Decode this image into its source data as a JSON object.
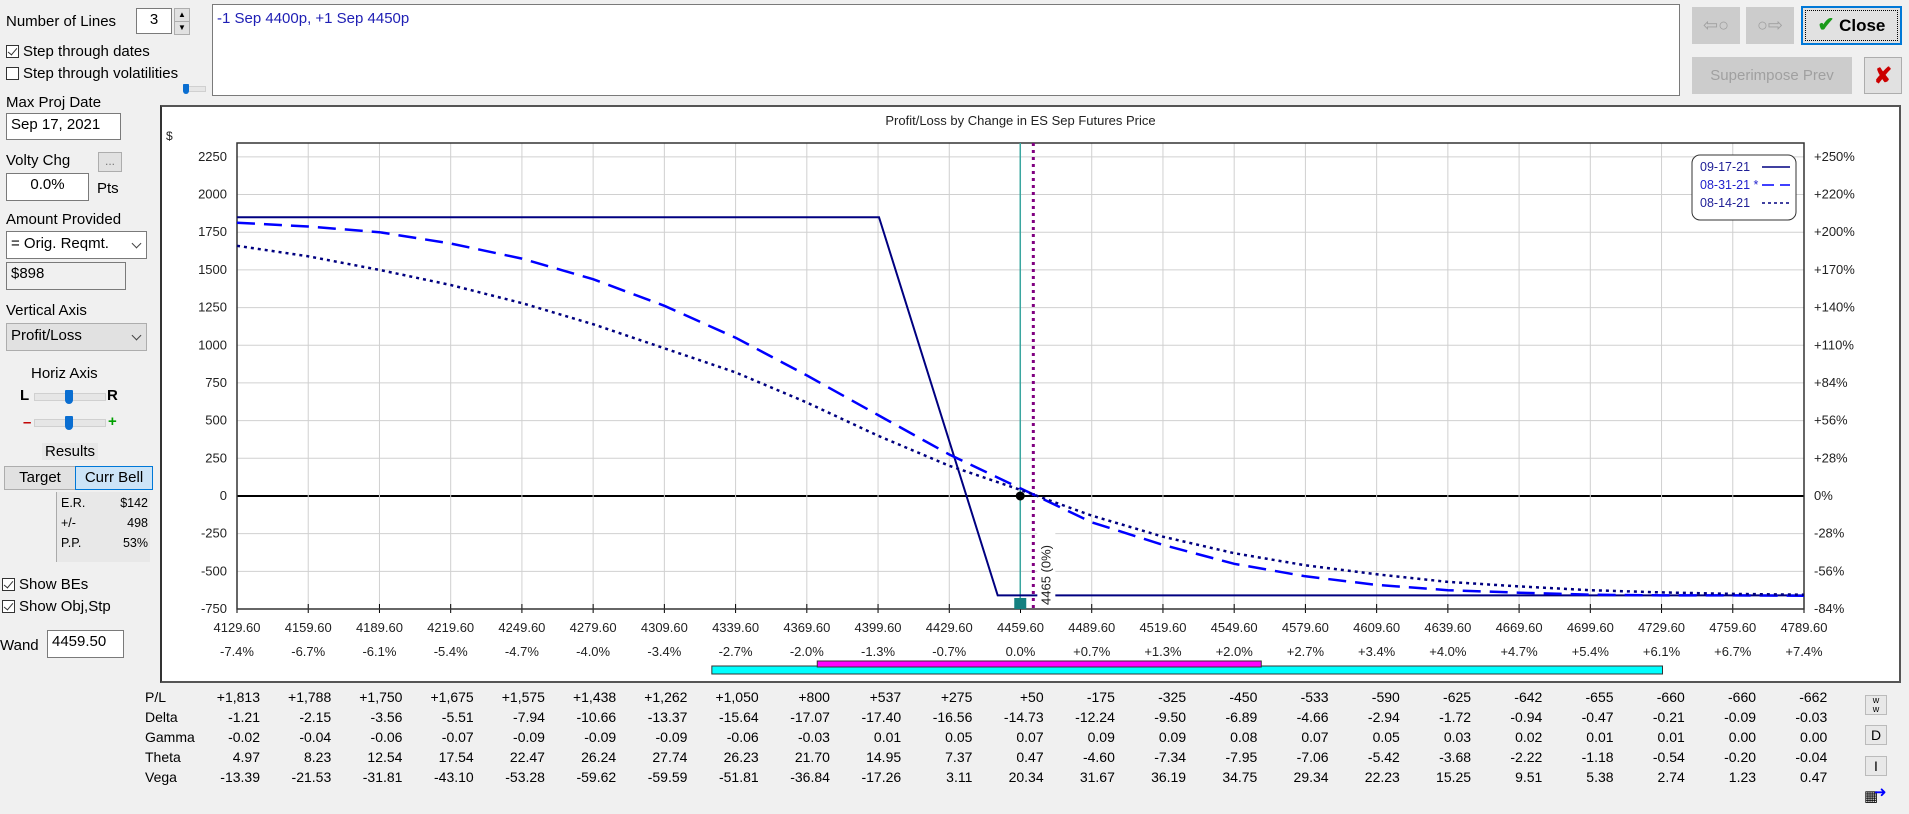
{
  "controls": {
    "num_lines_label": "Number of Lines",
    "num_lines_value": "3",
    "step_dates_label": "Step through dates",
    "step_dates_checked": true,
    "step_vols_label": "Step through volatilities",
    "step_vols_checked": false,
    "max_proj_date_label": "Max Proj Date",
    "max_proj_date_value": "Sep 17, 2021",
    "volty_chg_label": "Volty Chg",
    "volty_btn_label": "...",
    "volty_value": "0.0%",
    "volty_units": "Pts",
    "amount_label": "Amount Provided",
    "amount_select": "= Orig. Reqmt.",
    "amount_value": "$898",
    "vertical_axis_label": "Vertical Axis",
    "vertical_axis_select": "Profit/Loss",
    "horiz_axis_label": "Horiz Axis",
    "horiz_l": "L",
    "horiz_r": "R",
    "zoom_minus": "–",
    "zoom_plus": "+",
    "results_label": "Results",
    "target_btn": "Target",
    "curr_bell_btn": "Curr Bell",
    "results": [
      {
        "k": "E.R.",
        "v": "$142"
      },
      {
        "k": "+/-",
        "v": "498"
      },
      {
        "k": "P.P.",
        "v": "53%"
      }
    ],
    "show_bes_label": "Show BEs",
    "show_bes_checked": true,
    "show_obj_label": "Show Obj,Stp",
    "show_obj_checked": true,
    "wand_label": "Wand",
    "wand_value": "4459.50"
  },
  "position_text": "-1 Sep 4400p, +1 Sep 4450p",
  "top_buttons": {
    "prev_icon": "⇦○",
    "next_icon": "○⇨",
    "close_label": "Close",
    "superimpose_label": "Superimpose Prev",
    "cancel_icon": "✘"
  },
  "colors": {
    "line_expiry": "#000080",
    "line_dashed": "#0000ff",
    "line_dotted": "#000080",
    "current_price_line": "#3aa6a0",
    "target_line": "#800080",
    "cyan_bar": "#00ffff",
    "magenta_bar": "#ff00ff"
  },
  "chart_data": {
    "type": "line",
    "title": "Profit/Loss by Change in ES Sep Futures Price",
    "ylabel": "$",
    "ylim": [
      -750,
      2342
    ],
    "xlim": [
      4129.6,
      4789.6
    ],
    "y_ticks": [
      2250,
      2000,
      1750,
      1500,
      1250,
      1000,
      750,
      500,
      250,
      0,
      -250,
      -500,
      -750
    ],
    "y2_ticks": [
      "+250%",
      "+220%",
      "+200%",
      "+170%",
      "+140%",
      "+110%",
      "+84%",
      "+56%",
      "+28%",
      "0%",
      "-28%",
      "-56%",
      "-84%"
    ],
    "x_ticks": [
      4129.6,
      4159.6,
      4189.6,
      4219.6,
      4249.6,
      4279.6,
      4309.6,
      4339.6,
      4369.6,
      4399.6,
      4429.6,
      4459.6,
      4489.6,
      4519.6,
      4549.6,
      4579.6,
      4609.6,
      4639.6,
      4669.6,
      4699.6,
      4729.6,
      4759.6,
      4789.6
    ],
    "x_tick_labels": [
      "4129.60",
      "4159.60",
      "4189.60",
      "4219.60",
      "4249.60",
      "4279.60",
      "4309.60",
      "4339.60",
      "4369.60",
      "4399.60",
      "4429.60",
      "4459.60",
      "4489.60",
      "4519.60",
      "4549.60",
      "4579.60",
      "4609.60",
      "4639.60",
      "4669.60",
      "4699.60",
      "4729.60",
      "4759.60",
      "4789.60"
    ],
    "x_pct_labels": [
      "-7.4%",
      "-6.7%",
      "-6.1%",
      "-5.4%",
      "-4.7%",
      "-4.0%",
      "-3.4%",
      "-2.7%",
      "-2.0%",
      "-1.3%",
      "-0.7%",
      "0.0%",
      "+0.7%",
      "+1.3%",
      "+2.0%",
      "+2.7%",
      "+3.4%",
      "+4.0%",
      "+4.7%",
      "+5.4%",
      "+6.1%",
      "+6.7%",
      "+7.4%"
    ],
    "legend": [
      {
        "label": "09-17-21",
        "style": "solid"
      },
      {
        "label": "08-31-21 *",
        "style": "dashed"
      },
      {
        "label": "08-14-21",
        "style": "dotted"
      }
    ],
    "legend_position": "top-right",
    "grid": true,
    "series": [
      {
        "name": "09-17-21",
        "style": "solid",
        "x": [
          4129.6,
          4400,
          4450,
          4465,
          4789.6
        ],
        "y": [
          1850,
          1850,
          -660,
          -660,
          -660
        ]
      },
      {
        "name": "08-31-21",
        "style": "dashed",
        "x": [
          4129.6,
          4159.6,
          4189.6,
          4219.6,
          4249.6,
          4279.6,
          4309.6,
          4339.6,
          4369.6,
          4399.6,
          4429.6,
          4459.6,
          4489.6,
          4519.6,
          4549.6,
          4579.6,
          4609.6,
          4639.6,
          4669.6,
          4699.6,
          4729.6,
          4759.6,
          4789.6
        ],
        "y": [
          1813,
          1788,
          1750,
          1675,
          1575,
          1438,
          1262,
          1050,
          800,
          537,
          275,
          50,
          -175,
          -325,
          -450,
          -533,
          -590,
          -625,
          -642,
          -655,
          -660,
          -660,
          -662
        ]
      },
      {
        "name": "08-14-21",
        "style": "dotted",
        "x": [
          4129.6,
          4159.6,
          4189.6,
          4219.6,
          4249.6,
          4279.6,
          4309.6,
          4339.6,
          4369.6,
          4399.6,
          4429.6,
          4459.6,
          4489.6,
          4519.6,
          4549.6,
          4579.6,
          4609.6,
          4639.6,
          4669.6,
          4699.6,
          4729.6,
          4759.6,
          4789.6
        ],
        "y": [
          1660,
          1590,
          1500,
          1400,
          1280,
          1140,
          980,
          820,
          620,
          400,
          200,
          40,
          -130,
          -270,
          -380,
          -460,
          -520,
          -570,
          -600,
          -625,
          -640,
          -650,
          -655
        ]
      }
    ],
    "current_price": 4459.5,
    "target_price": 4465,
    "target_label": "4465 (0%)",
    "current_marker_pl": 0,
    "cyan_range": [
      4329.6,
      4730
    ],
    "magenta_range": [
      4374,
      4561
    ]
  },
  "greeks": {
    "rows": [
      {
        "label": "P/L",
        "values": [
          "+1,813",
          "+1,788",
          "+1,750",
          "+1,675",
          "+1,575",
          "+1,438",
          "+1,262",
          "+1,050",
          "+800",
          "+537",
          "+275",
          "+50",
          "-175",
          "-325",
          "-450",
          "-533",
          "-590",
          "-625",
          "-642",
          "-655",
          "-660",
          "-660",
          "-662"
        ]
      },
      {
        "label": "Delta",
        "values": [
          "-1.21",
          "-2.15",
          "-3.56",
          "-5.51",
          "-7.94",
          "-10.66",
          "-13.37",
          "-15.64",
          "-17.07",
          "-17.40",
          "-16.56",
          "-14.73",
          "-12.24",
          "-9.50",
          "-6.89",
          "-4.66",
          "-2.94",
          "-1.72",
          "-0.94",
          "-0.47",
          "-0.21",
          "-0.09",
          "-0.03"
        ]
      },
      {
        "label": "Gamma",
        "values": [
          "-0.02",
          "-0.04",
          "-0.06",
          "-0.07",
          "-0.09",
          "-0.09",
          "-0.09",
          "-0.06",
          "-0.03",
          "0.01",
          "0.05",
          "0.07",
          "0.09",
          "0.09",
          "0.08",
          "0.07",
          "0.05",
          "0.03",
          "0.02",
          "0.01",
          "0.01",
          "0.00",
          "0.00"
        ]
      },
      {
        "label": "Theta",
        "values": [
          "4.97",
          "8.23",
          "12.54",
          "17.54",
          "22.47",
          "26.24",
          "27.74",
          "26.23",
          "21.70",
          "14.95",
          "7.37",
          "0.47",
          "-4.60",
          "-7.34",
          "-7.95",
          "-7.06",
          "-5.42",
          "-3.68",
          "-2.22",
          "-1.18",
          "-0.54",
          "-0.20",
          "-0.04"
        ]
      },
      {
        "label": "Vega",
        "values": [
          "-13.39",
          "-21.53",
          "-31.81",
          "-43.10",
          "-53.28",
          "-59.62",
          "-59.59",
          "-51.81",
          "-36.84",
          "-17.26",
          "3.11",
          "20.34",
          "31.67",
          "36.19",
          "34.75",
          "29.34",
          "22.23",
          "15.25",
          "9.51",
          "5.38",
          "2.74",
          "1.23",
          "0.47"
        ]
      }
    ],
    "side_buttons": [
      "w/w",
      "D",
      "I"
    ]
  }
}
